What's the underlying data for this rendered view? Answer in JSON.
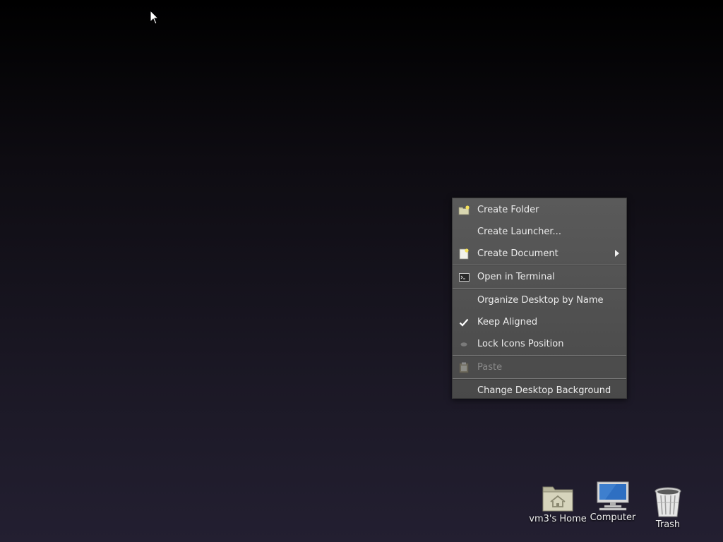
{
  "context_menu": {
    "items": [
      {
        "label": "Create Folder",
        "icon": "folder-new-icon",
        "has_submenu": false,
        "disabled": false
      },
      {
        "label": "Create Launcher...",
        "icon": "",
        "has_submenu": false,
        "disabled": false
      },
      {
        "label": "Create Document",
        "icon": "document-new-icon",
        "has_submenu": true,
        "disabled": false
      },
      {
        "label": "Open in Terminal",
        "icon": "terminal-icon",
        "has_submenu": false,
        "disabled": false
      },
      {
        "label": "Organize Desktop by Name",
        "icon": "",
        "has_submenu": false,
        "disabled": false
      },
      {
        "label": "Keep Aligned",
        "icon": "checkmark-icon",
        "checked": true,
        "disabled": false
      },
      {
        "label": "Lock Icons Position",
        "icon": "unchecked-radio-icon",
        "checked": false,
        "disabled": false
      },
      {
        "label": "Paste",
        "icon": "paste-icon",
        "has_submenu": false,
        "disabled": true
      },
      {
        "label": "Change Desktop Background",
        "icon": "",
        "has_submenu": false,
        "disabled": false
      }
    ]
  },
  "desktop_icons": {
    "home": {
      "label": "vm3's Home",
      "icon": "home-folder-icon"
    },
    "computer": {
      "label": "Computer",
      "icon": "computer-icon"
    },
    "trash": {
      "label": "Trash",
      "icon": "trash-icon"
    }
  },
  "colors": {
    "menu_bg": "#525252",
    "menu_text": "#ececec",
    "menu_disabled_text": "#8a8a8a",
    "desktop_top": "#000000",
    "desktop_bottom": "#231f31"
  }
}
